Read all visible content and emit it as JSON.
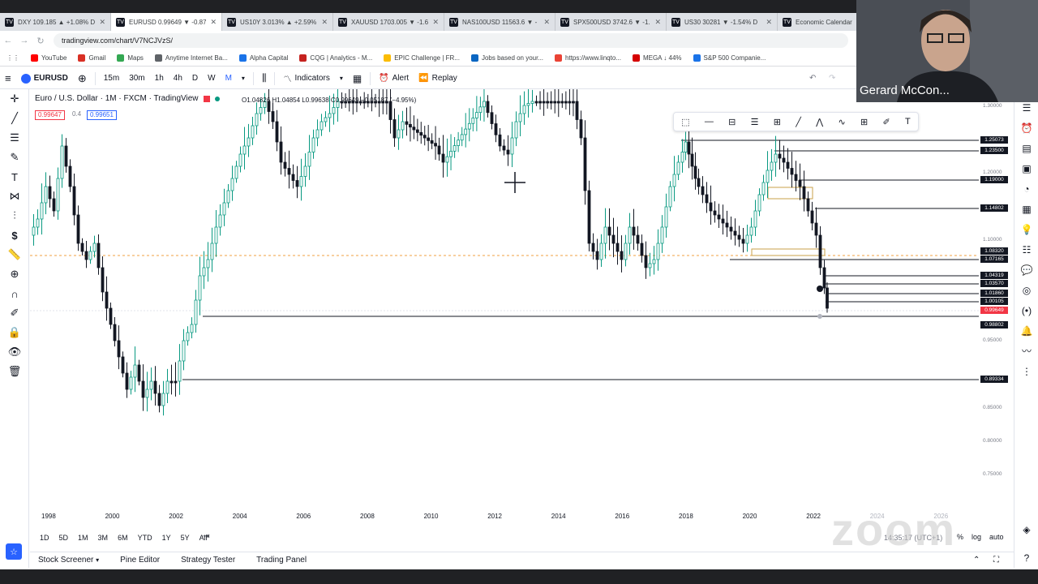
{
  "browser": {
    "tabs": [
      {
        "title": "DXY 109.185 ▲ +1.08% D",
        "active": false
      },
      {
        "title": "EURUSD 0.99649 ▼ -0.87%",
        "active": true
      },
      {
        "title": "US10Y 3.013% ▲ +2.59%",
        "active": false
      },
      {
        "title": "XAUUSD 1703.005 ▼ -1.6",
        "active": false
      },
      {
        "title": "NAS100USD 11563.6 ▼ -",
        "active": false
      },
      {
        "title": "SPX500USD 3742.6 ▼ -1.",
        "active": false
      },
      {
        "title": "US30 30281 ▼ -1.54% D",
        "active": false
      },
      {
        "title": "Economic Calendar",
        "active": false
      }
    ],
    "url": "tradingview.com/chart/V7NCJVzS/",
    "bookmarks": [
      "YouTube",
      "Gmail",
      "Maps",
      "Anytime Internet Ba...",
      "Alpha Capital",
      "CQG | Analytics - M...",
      "EPIC Challenge | FR...",
      "Jobs based on your...",
      "https://www.linqto...",
      "MEGA ↓ 44%",
      "S&P 500 Companie..."
    ]
  },
  "toolbar": {
    "symbol": "EURUSD",
    "intervals": [
      "15m",
      "30m",
      "1h",
      "4h",
      "D",
      "W",
      "M"
    ],
    "indicators_label": "Indicators",
    "alert_label": "Alert",
    "replay_label": "Replay"
  },
  "legend": {
    "title": "Euro / U.S. Dollar · 1M · FXCM · TradingView",
    "ohlc": "O1.04826 H1.04854 L0.99638 C0.99649 −0.05187 (−4.95%)",
    "bid": "0.99647",
    "spread": "0.4",
    "ask": "0.99651"
  },
  "price_tags": [
    {
      "label": "1.25073",
      "color": "#131722"
    },
    {
      "label": "1.23500",
      "color": "#131722"
    },
    {
      "label": "1.19000",
      "color": "#131722"
    },
    {
      "label": "1.14802",
      "color": "#131722"
    },
    {
      "label": "1.08320",
      "color": "#131722"
    },
    {
      "label": "1.07165",
      "color": "#131722"
    },
    {
      "label": "1.04319",
      "color": "#131722"
    },
    {
      "label": "1.03570",
      "color": "#131722"
    },
    {
      "label": "1.01860",
      "color": "#131722"
    },
    {
      "label": "1.00105",
      "color": "#131722"
    },
    {
      "label": "0.99649",
      "color": "#f23645"
    },
    {
      "label": "0.98802",
      "color": "#131722"
    },
    {
      "label": "0.89334",
      "color": "#131722"
    }
  ],
  "axis_ticks": [
    "1.30000",
    "1.20000",
    "1.10000",
    "0.95000",
    "0.85000",
    "0.80000",
    "0.75000"
  ],
  "time_axis": [
    "1998",
    "2000",
    "2002",
    "2004",
    "2006",
    "2008",
    "2010",
    "2012",
    "2014",
    "2016",
    "2018",
    "2020",
    "2022",
    "2024",
    "2026"
  ],
  "ranges": [
    "1D",
    "5D",
    "1M",
    "3M",
    "6M",
    "YTD",
    "1Y",
    "5Y",
    "All"
  ],
  "timezone": "14:35:17 (UTC+1)",
  "scale_opts": [
    "%",
    "log",
    "auto"
  ],
  "bottom_tabs": [
    "Stock Screener",
    "Pine Editor",
    "Strategy Tester",
    "Trading Panel"
  ],
  "webcam_name": "Gerard McCon...",
  "watermark": "zoom"
}
